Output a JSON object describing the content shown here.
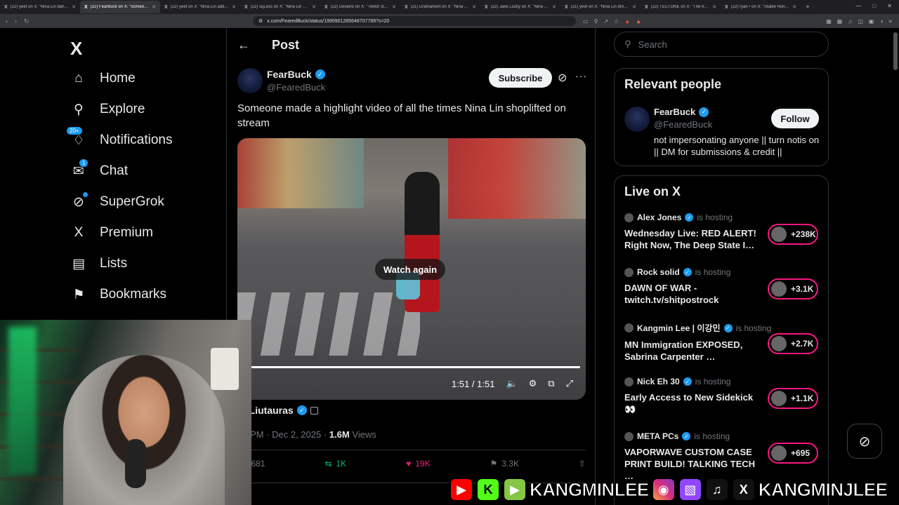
{
  "browser": {
    "tabs": [
      {
        "label": "(22) yeet on X: \"Nina Lin banned o…",
        "active": false
      },
      {
        "label": "(22) FearBuck on X: \"Someone…",
        "active": true
      },
      {
        "label": "(22) yeet on X: \"Nina Lin addresse…",
        "active": false
      },
      {
        "label": "(22) sųLexs on X: \"Nina Lin was ca…",
        "active": false
      },
      {
        "label": "(22) Deserto on X: \"Twitch streame…",
        "active": false
      },
      {
        "label": "(21) DramaAlert on X: \"Nina Lin &…",
        "active": false
      },
      {
        "label": "(22) Jake Lucky on X: \"Nina Lin is j…",
        "active": false
      },
      {
        "label": "(21) yeet on X: \"Nina Lin drops an…",
        "active": false
      },
      {
        "label": "(22) TECTONE on X: \"The transp…",
        "active": false
      },
      {
        "label": "(22) ryan • on X: \"Stable Ronaldo…",
        "active": false
      }
    ],
    "new_tab": "+",
    "url": "x.com/FearedBuck/status/1995901285648707789?s=20"
  },
  "nav": {
    "logo": "X",
    "items": [
      {
        "label": "Home",
        "icon": "home-icon"
      },
      {
        "label": "Explore",
        "icon": "search-icon"
      },
      {
        "label": "Notifications",
        "icon": "bell-icon"
      },
      {
        "label": "Chat",
        "icon": "mail-icon"
      },
      {
        "label": "SuperGrok",
        "icon": "grok-icon"
      },
      {
        "label": "Premium",
        "icon": "x-icon"
      },
      {
        "label": "Lists",
        "icon": "list-icon"
      },
      {
        "label": "Bookmarks",
        "icon": "bookmark-icon"
      }
    ],
    "notifications_badge": "20+",
    "chat_badge": "1"
  },
  "post": {
    "header": "Post",
    "author_name": "FearBuck",
    "author_handle": "@FearedBuck",
    "subscribe_label": "Subscribe",
    "text": "Someone made a highlight video of all the times Nina Lin shoplifted on stream",
    "video": {
      "watch_again": "Watch again",
      "time": "1:51 / 1:51",
      "progress": 1.0
    },
    "quoted_name": "Liutauras",
    "quoted_prefix": "m",
    "timestamp": "02 PM · Dec 2, 2025 ·",
    "views_count": "1.6M",
    "views_label": "Views",
    "replies": "681",
    "reposts": "1K",
    "likes": "19K",
    "bookmarks": "3.3K"
  },
  "sidebar": {
    "search_placeholder": "Search",
    "relevant_title": "Relevant people",
    "person": {
      "name": "FearBuck",
      "handle": "@FearedBuck",
      "bio": "not impersonating anyone || turn notis on || DM for submissions & credit ||",
      "follow_label": "Follow"
    },
    "live_title": "Live on X",
    "hosting_label": "is hosting",
    "live": [
      {
        "host": "Alex Jones",
        "title": "Wednesday Live: RED ALERT! Right Now, The Deep State I…",
        "count": "+238K"
      },
      {
        "host": "Rock solid",
        "title": "DAWN OF WAR - twitch.tv/shitpostrock",
        "count": "+3.1K"
      },
      {
        "host": "Kangmin Lee | 이강민",
        "title": "MN Immigration EXPOSED, Sabrina Carpenter …",
        "count": "+2.7K"
      },
      {
        "host": "Nick Eh 30",
        "title": "Early Access to New Sidekick 👀",
        "count": "+1.1K"
      },
      {
        "host": "META PCs",
        "title": "VAPORWAVE CUSTOM CASE PRINT BUILD! TALKING TECH …",
        "count": "+695"
      }
    ]
  },
  "overlay": {
    "handle_1": "KANGMINLEE",
    "handle_2": "KANGMINJLEE"
  }
}
